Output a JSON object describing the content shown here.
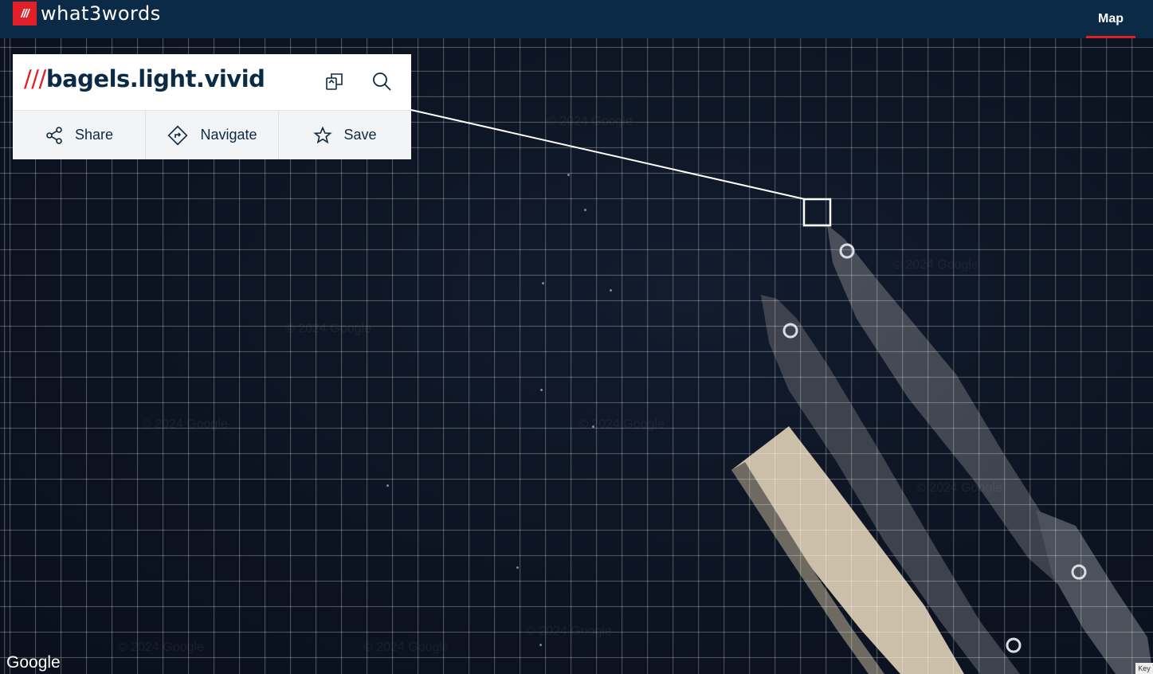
{
  "header": {
    "logo_mark": "///",
    "logo_text": "what3words",
    "nav_map_label": "Map",
    "accent_color": "#e11f26",
    "bg_color": "#0b2a45"
  },
  "panel": {
    "slashes": "///",
    "address": "bagels.light.vivid",
    "copy_icon": "copy-icon",
    "search_icon": "search-icon",
    "actions": [
      {
        "label": "Share",
        "icon": "share-icon"
      },
      {
        "label": "Navigate",
        "icon": "navigate-icon"
      },
      {
        "label": "Save",
        "icon": "star-icon"
      }
    ]
  },
  "map": {
    "type": "satellite",
    "watermark": "© 2024 Google",
    "attribution": "Google",
    "keyboard_label": "Key"
  }
}
